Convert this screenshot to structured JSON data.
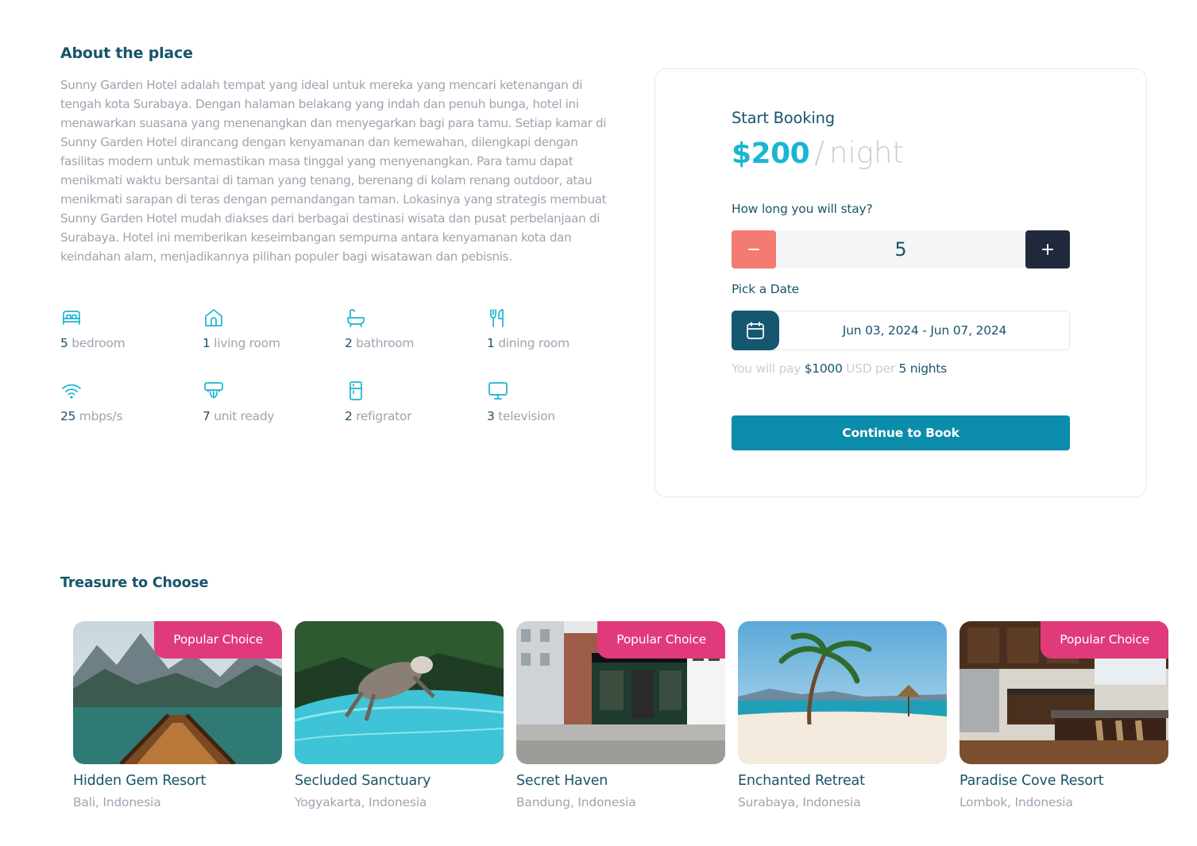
{
  "about": {
    "title": "About the place",
    "description": "Sunny Garden Hotel adalah tempat yang ideal untuk mereka yang mencari ketenangan di tengah kota Surabaya. Dengan halaman belakang yang indah dan penuh bunga, hotel ini menawarkan suasana yang menenangkan dan menyegarkan bagi para tamu. Setiap kamar di Sunny Garden Hotel dirancang dengan kenyamanan dan kemewahan, dilengkapi dengan fasilitas modern untuk memastikan masa tinggal yang menyenangkan. Para tamu dapat menikmati waktu bersantai di taman yang tenang, berenang di kolam renang outdoor, atau menikmati sarapan di teras dengan pemandangan taman. Lokasinya yang strategis membuat Sunny Garden Hotel mudah diakses dari berbagai destinasi wisata dan pusat perbelanjaan di Surabaya. Hotel ini memberikan keseimbangan sempurna antara kenyamanan kota dan keindahan alam, menjadikannya pilihan populer bagi wisatawan dan pebisnis."
  },
  "features": [
    {
      "icon": "bed-icon",
      "num": "5",
      "label": "bedroom"
    },
    {
      "icon": "home-icon",
      "num": "1",
      "label": "living room"
    },
    {
      "icon": "bathtub-icon",
      "num": "2",
      "label": "bathroom"
    },
    {
      "icon": "utensils-icon",
      "num": "1",
      "label": "dining room"
    },
    {
      "icon": "wifi-icon",
      "num": "25",
      "label": "mbps/s"
    },
    {
      "icon": "air-conditioner-icon",
      "num": "7",
      "label": "unit ready"
    },
    {
      "icon": "refrigerator-icon",
      "num": "2",
      "label": "refigrator"
    },
    {
      "icon": "television-icon",
      "num": "3",
      "label": "television"
    }
  ],
  "booking": {
    "title": "Start Booking",
    "price": "$200",
    "separator": "/",
    "unit": "night",
    "stay_label": "How long you will stay?",
    "nights": "5",
    "date_label": "Pick a Date",
    "date_range": "Jun 03, 2024 - Jun 07, 2024",
    "pay_prefix": "You will pay",
    "pay_amount": "$1000",
    "pay_currency": "USD per",
    "pay_nights": "5 nights",
    "cta": "Continue to Book"
  },
  "treasure": {
    "title": "Treasure to Choose",
    "badge": "Popular Choice",
    "items": [
      {
        "name": "Hidden Gem Resort",
        "location": "Bali, Indonesia",
        "popular": true
      },
      {
        "name": "Secluded Sanctuary",
        "location": "Yogyakarta, Indonesia",
        "popular": false
      },
      {
        "name": "Secret Haven",
        "location": "Bandung, Indonesia",
        "popular": true
      },
      {
        "name": "Enchanted Retreat",
        "location": "Surabaya, Indonesia",
        "popular": false
      },
      {
        "name": "Paradise Cove Resort",
        "location": "Lombok, Indonesia",
        "popular": true
      }
    ]
  },
  "colors": {
    "primary": "#17556b",
    "accent": "#1ab5d1",
    "cta": "#0c8cab",
    "minus": "#f47a74",
    "plus": "#212a3c",
    "badge": "#e03a7b"
  }
}
